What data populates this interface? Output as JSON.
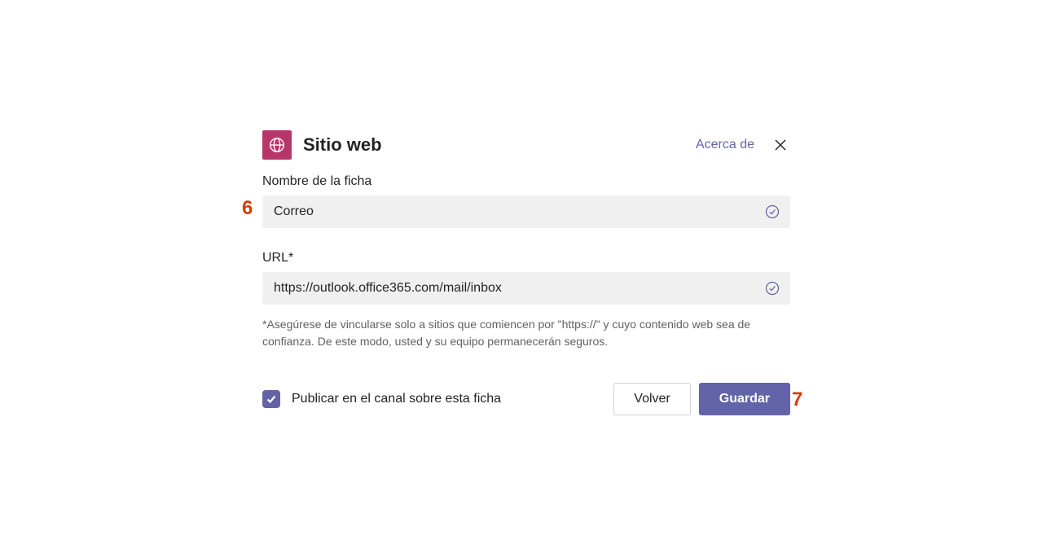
{
  "header": {
    "title": "Sitio web",
    "about_label": "Acerca de"
  },
  "fields": {
    "tab_name": {
      "label": "Nombre de la ficha",
      "value": "Correo"
    },
    "url": {
      "label": "URL*",
      "value": "https://outlook.office365.com/mail/inbox"
    },
    "hint": "*Asegúrese de vincularse solo a sitios que comiencen por \"https://\" y cuyo contenido web sea de confianza. De este modo, usted y su equipo permanecerán seguros."
  },
  "footer": {
    "checkbox_label": "Publicar en el canal sobre esta ficha",
    "back_label": "Volver",
    "save_label": "Guardar"
  },
  "annotations": {
    "six": "6",
    "seven": "7"
  }
}
